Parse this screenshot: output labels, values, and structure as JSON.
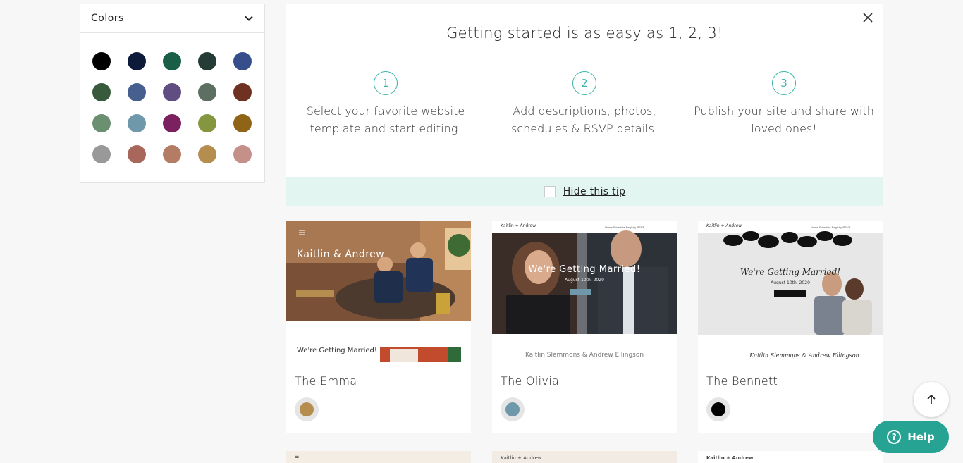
{
  "sidebar": {
    "title": "Colors",
    "swatches": [
      "#000000",
      "#0d1a3a",
      "#1a5e48",
      "#243b36",
      "#364f8c",
      "#385a3c",
      "#475f8f",
      "#604d82",
      "#5d6f63",
      "#6e3122",
      "#6a8f71",
      "#6f98ab",
      "#7c2160",
      "#859640",
      "#8f6417",
      "#999999",
      "#a8675a",
      "#b47c64",
      "#b58d4f",
      "#c6908a"
    ]
  },
  "tip": {
    "title": "Getting started is as easy as 1, 2, 3!",
    "steps": [
      {
        "num": "1",
        "line1": "Select your favorite website",
        "line2": "template and start editing."
      },
      {
        "num": "2",
        "line1": "Add descriptions, photos,",
        "line2": "schedules & RSVP details."
      },
      {
        "num": "3",
        "line1": "Publish your site and share with",
        "line2": "loved ones!"
      }
    ],
    "hide_label": "Hide this tip"
  },
  "cards": [
    {
      "name": "The Emma",
      "color": "#b58d4f",
      "couple": "Kaitlin & Andrew",
      "sub": "We're Getting Married!"
    },
    {
      "name": "The Olivia",
      "color": "#6f98ab",
      "headline": "We're Getting Married!",
      "date": "August 10th, 2020",
      "brand": "Kaitlin + Andrew",
      "couple_full": "Kaitlin Slemmons & Andrew Ellingson"
    },
    {
      "name": "The Bennett",
      "color": "#000000",
      "brand": "Kaitlin + Andrew",
      "headline": "We're Getting Married!",
      "date": "August 10th, 2020",
      "couple_full": "Kaitlin Slemmons & Andrew Ellingson"
    }
  ],
  "next_row": [
    {
      "brand": ""
    },
    {
      "brand": "Kaitlin + Andrew"
    },
    {
      "brand": "Kaitlin + Andrew"
    }
  ],
  "help": {
    "label": "Help"
  }
}
